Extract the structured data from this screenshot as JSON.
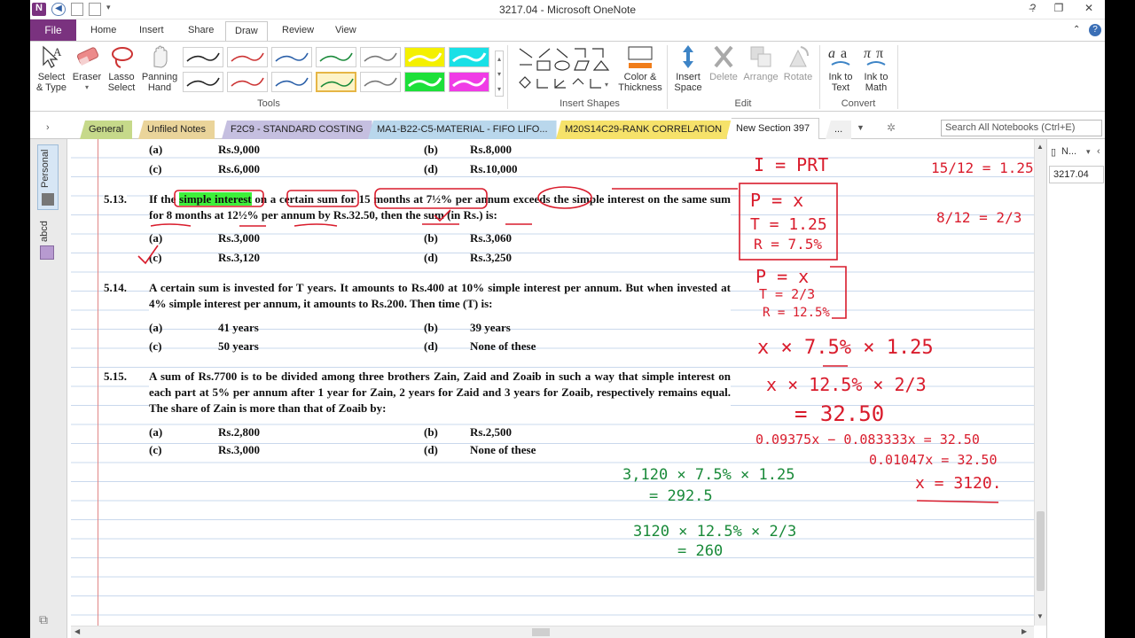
{
  "window": {
    "title": "3217.04 - Microsoft OneNote",
    "controls": [
      "?",
      "–",
      "❐",
      "✕"
    ]
  },
  "ribbon_tabs": [
    "File",
    "Home",
    "Insert",
    "Share",
    "Draw",
    "Review",
    "View"
  ],
  "active_tab": "Draw",
  "tools": {
    "select": "Select\n& Type",
    "eraser": "Eraser",
    "lasso": "Lasso\nSelect",
    "panning": "Panning\nHand",
    "group": "Tools"
  },
  "shapes": {
    "group": "Insert Shapes",
    "color": "Color &\nThickness"
  },
  "edit": {
    "insert_space": "Insert\nSpace",
    "delete": "Delete",
    "arrange": "Arrange",
    "rotate": "Rotate",
    "group": "Edit"
  },
  "convert": {
    "ink_to_text": "Ink to\nText",
    "ink_to_math": "Ink to\nMath",
    "group": "Convert"
  },
  "sections": [
    {
      "label": "General",
      "color": "#c6d98a"
    },
    {
      "label": "Unfiled Notes",
      "color": "#ead49a"
    },
    {
      "label": "F2C9 - STANDARD COSTING",
      "color": "#c5bfe0"
    },
    {
      "label": "MA1-B22-C5-MATERIAL - FIFO LIFO...",
      "color": "#b9d7ec"
    },
    {
      "label": "M20S14C29-RANK CORRELATION",
      "color": "#f6e26a"
    },
    {
      "label": "New Section 397",
      "color": "#ffffff"
    },
    {
      "label": "...",
      "color": "#f0f0f0"
    }
  ],
  "search_placeholder": "Search All Notebooks (Ctrl+E)",
  "left_notebooks": [
    "Personal",
    "abcd"
  ],
  "right_panel": {
    "header": "N...",
    "page": "3217.04"
  },
  "questions": [
    {
      "num": "",
      "text_parts": [],
      "options": [
        [
          "(a)",
          "Rs.9,000"
        ],
        [
          "(b)",
          "Rs.8,000"
        ],
        [
          "(c)",
          "Rs.6,000"
        ],
        [
          "(d)",
          "Rs.10,000"
        ]
      ]
    },
    {
      "num": "5.13.",
      "pre": "If the ",
      "hl": "simple interest",
      "post": " on a certain sum for 15 months at 7½% per annum exceeds the simple interest on the same sum for 8 months at 12½% per annum by Rs.32.50, then the sum (in Rs.) is:",
      "options": [
        [
          "(a)",
          "Rs.3,000"
        ],
        [
          "(b)",
          "Rs.3,060"
        ],
        [
          "(c)",
          "Rs.3,120"
        ],
        [
          "(d)",
          "Rs.3,250"
        ]
      ]
    },
    {
      "num": "5.14.",
      "text": "A certain sum is invested for T years. It amounts to Rs.400 at 10% simple interest per annum. But when invested at 4% simple interest per annum, it amounts to Rs.200. Then time (T) is:",
      "options": [
        [
          "(a)",
          "41 years"
        ],
        [
          "(b)",
          "39 years"
        ],
        [
          "(c)",
          "50 years"
        ],
        [
          "(d)",
          "None of these"
        ]
      ]
    },
    {
      "num": "5.15.",
      "text": "A sum of Rs.7700 is to be divided among three brothers Zain, Zaid and Zoaib in such a way that simple interest on each part at 5% per annum after 1 year for Zain, 2 years for Zaid and 3 years for Zoaib, respectively remains equal. The share of Zain is more than that of Zoaib by:",
      "options": [
        [
          "(a)",
          "Rs.2,800"
        ],
        [
          "(b)",
          "Rs.2,500"
        ],
        [
          "(c)",
          "Rs.3,000"
        ],
        [
          "(d)",
          "None of these"
        ]
      ]
    }
  ],
  "ink_red": [
    "I = PRT",
    "P = x",
    "T = 1.25",
    "R = 7.5%",
    "P = x",
    "T = 2/3",
    "R = 12.5%",
    "x × 7.5% × 1.25",
    "x × 12.5% × 2/3",
    "= 32.50",
    "0.09375x − 0.083333x = 32.50",
    "0.01047x = 32.50",
    "x = 3120.",
    "15/12 = 1.25",
    "8/12 = 2/3"
  ],
  "ink_green": [
    "3,120 × 7.5% × 1.25",
    "= 292.5",
    "3120 × 12.5% × 2/3",
    "= 260"
  ],
  "colors": {
    "file_tab": "#7a327f",
    "ink_red": "#d91c2c",
    "ink_green": "#1a8a3a",
    "highlight": "#3ef03a"
  }
}
